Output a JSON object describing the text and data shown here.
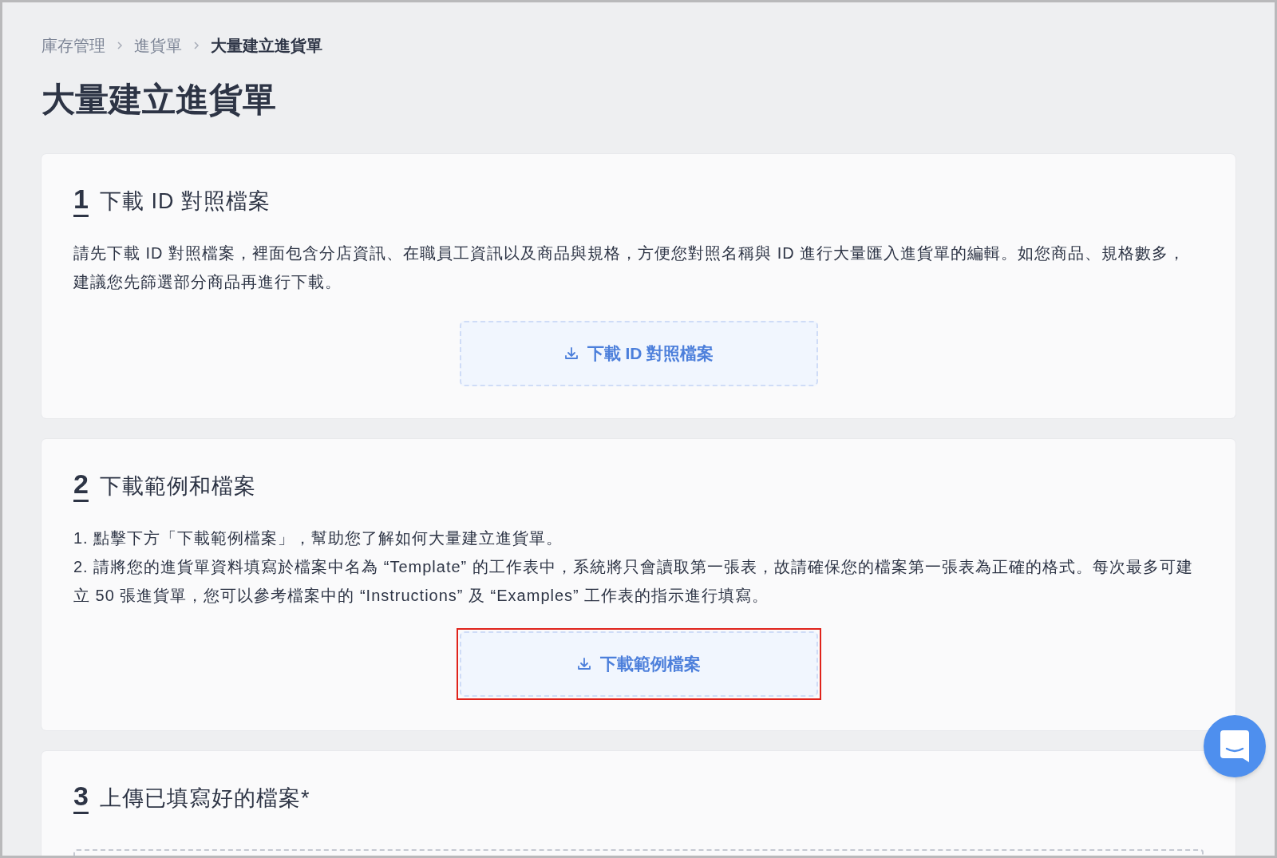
{
  "breadcrumb": [
    {
      "label": "庫存管理",
      "current": false
    },
    {
      "label": "進貨單",
      "current": false
    },
    {
      "label": "大量建立進貨單",
      "current": true
    }
  ],
  "page_title": "大量建立進貨單",
  "steps": [
    {
      "number": "1",
      "title": "下載 ID 對照檔案",
      "paragraphs": [
        "請先下載 ID 對照檔案，裡面包含分店資訊、在職員工資訊以及商品與規格，方便您對照名稱與 ID 進行大量匯入進貨單的編輯。如您商品、規格數多，建議您先篩選部分商品再進行下載。"
      ],
      "button": {
        "label": "下載 ID 對照檔案",
        "highlighted": false
      }
    },
    {
      "number": "2",
      "title": "下載範例和檔案",
      "paragraphs": [
        "1. 點擊下方「下載範例檔案」，幫助您了解如何大量建立進貨單。",
        "2. 請將您的進貨單資料填寫於檔案中名為 “Template” 的工作表中，系統將只會讀取第一張表，故請確保您的檔案第一張表為正確的格式。每次最多可建立 50 張進貨單，您可以參考檔案中的 “Instructions” 及 “Examples” 工作表的指示進行填寫。"
      ],
      "button": {
        "label": "下載範例檔案",
        "highlighted": true
      }
    },
    {
      "number": "3",
      "title": "上傳已填寫好的檔案*",
      "kind": "upload"
    }
  ]
}
